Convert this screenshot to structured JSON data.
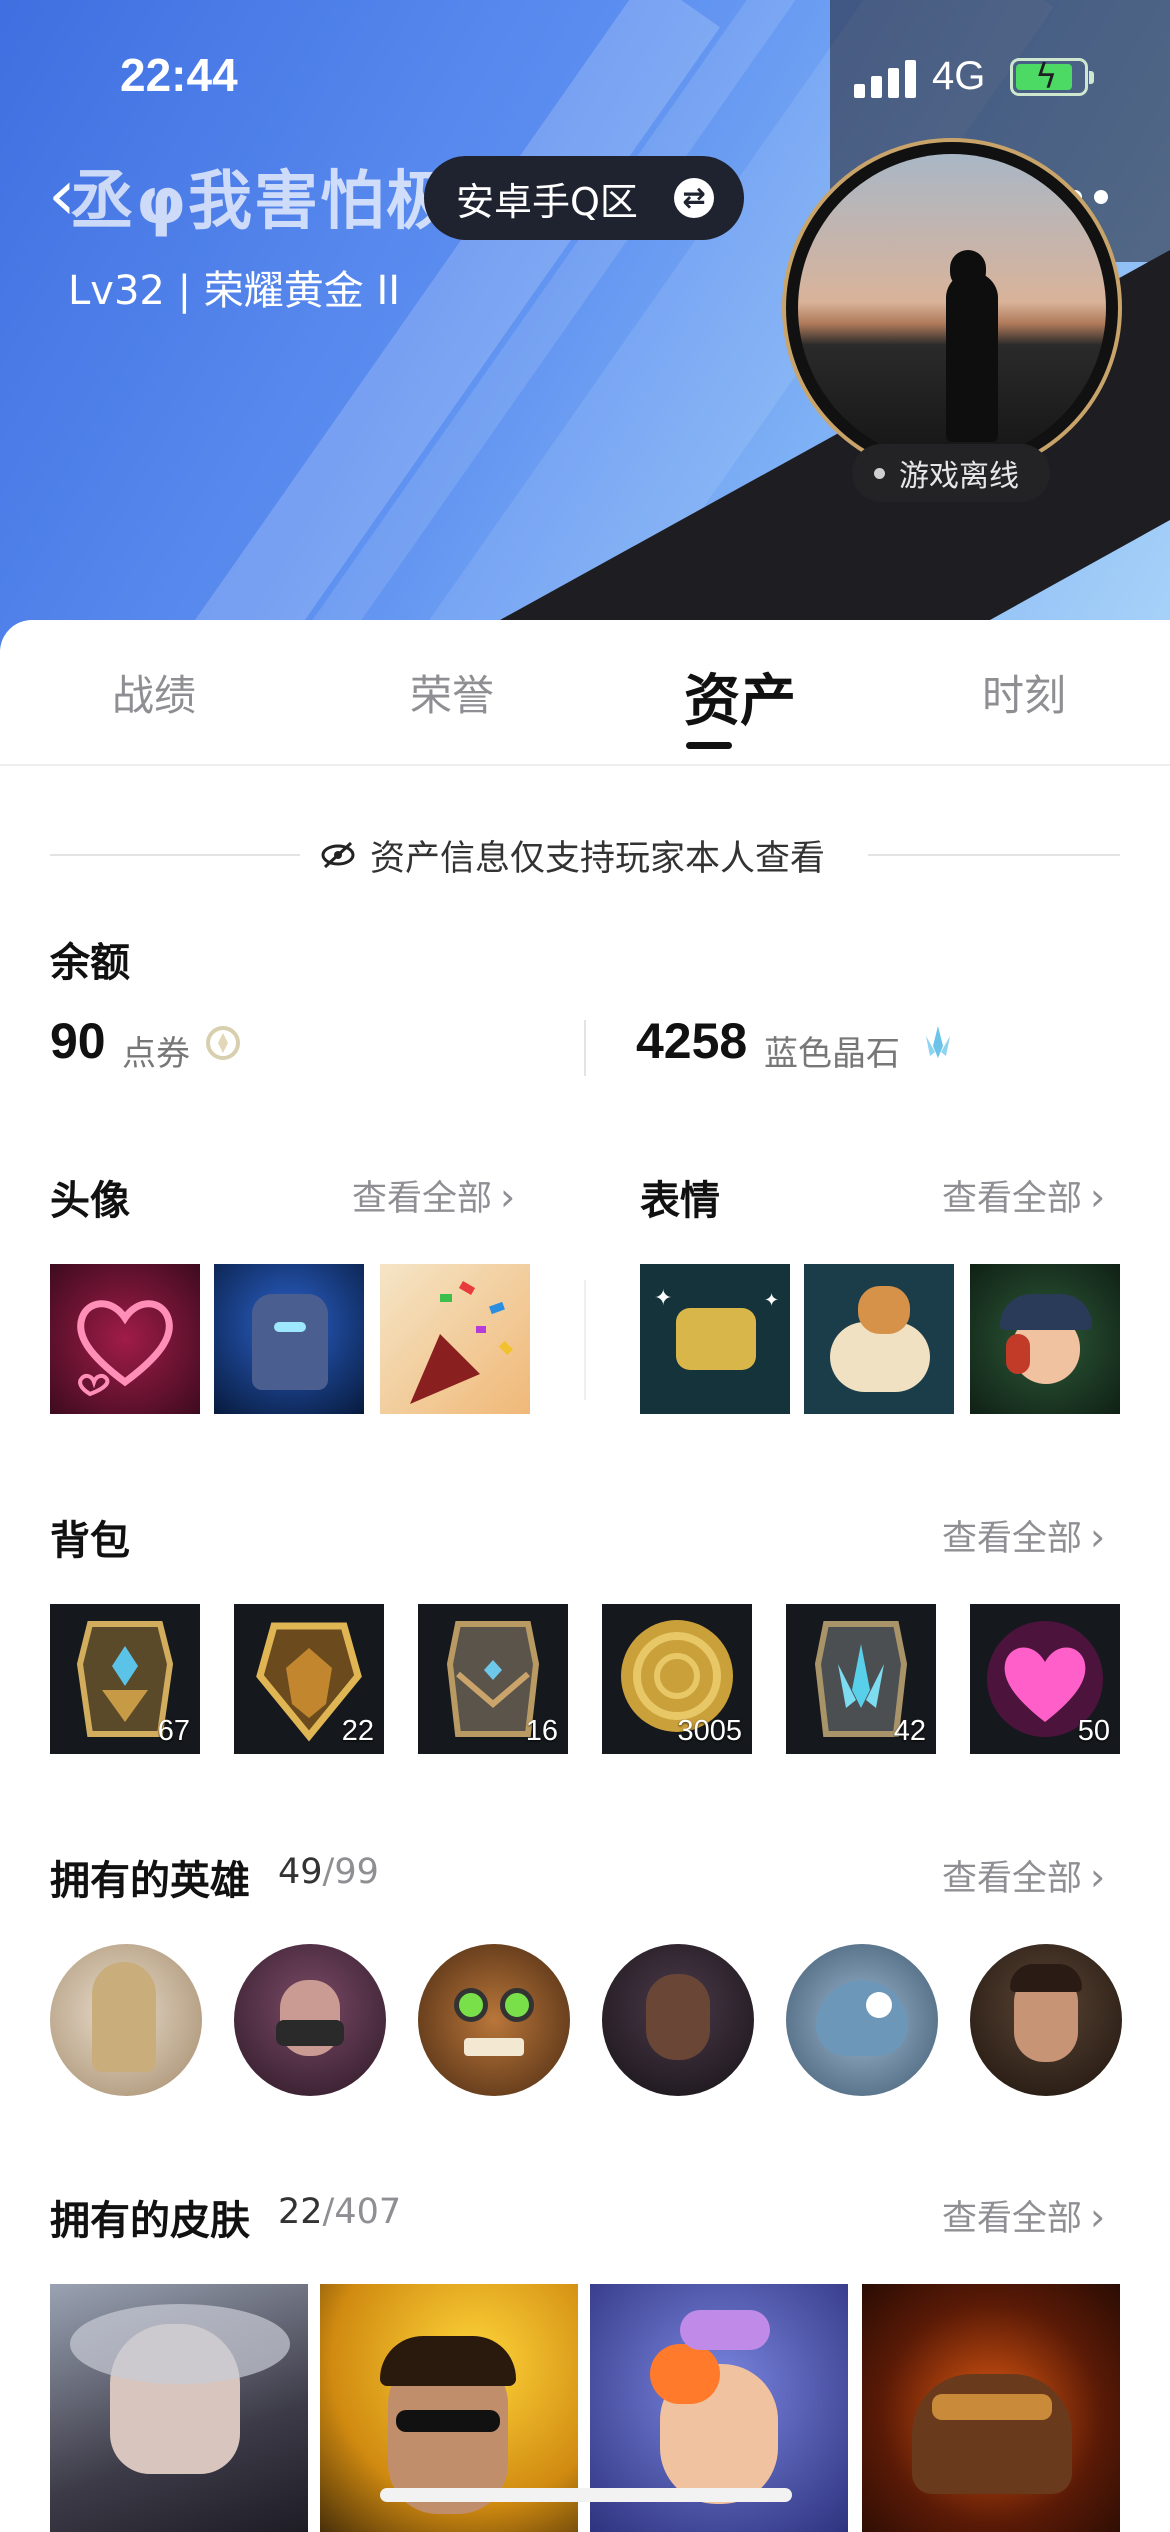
{
  "status_bar": {
    "time": "22:44",
    "network": "4G"
  },
  "header": {
    "nickname": "丞φ我害怕极了",
    "region": "安卓手Q区",
    "level": "Lv32 | 荣耀黄金 II",
    "presence": "游戏离线"
  },
  "tabs": [
    "战绩",
    "荣誉",
    "资产",
    "时刻"
  ],
  "active_tab": "资产",
  "notice": "资产信息仅支持玩家本人查看",
  "balance": {
    "title": "余额",
    "points": {
      "value": "90",
      "unit": "点券"
    },
    "crystals": {
      "value": "4258",
      "unit": "蓝色晶石"
    }
  },
  "avatars": {
    "title": "头像",
    "view_all": "查看全部"
  },
  "emotes": {
    "title": "表情",
    "view_all": "查看全部"
  },
  "backpack": {
    "title": "背包",
    "view_all": "查看全部",
    "items": [
      {
        "icon": "gold-chest-blue-gem-icon",
        "count": "67"
      },
      {
        "icon": "gold-crest-chest-icon",
        "count": "22"
      },
      {
        "icon": "gold-chest-icon",
        "count": "16"
      },
      {
        "icon": "gold-coin-icon",
        "count": "3005"
      },
      {
        "icon": "blue-crystal-chest-icon",
        "count": "42"
      },
      {
        "icon": "pink-heart-icon",
        "count": "50"
      }
    ]
  },
  "heroes": {
    "title": "拥有的英雄",
    "owned": "49",
    "total": "/99",
    "view_all": "查看全部"
  },
  "skins": {
    "title": "拥有的皮肤",
    "owned": "22",
    "total": "/407",
    "view_all": "查看全部"
  },
  "colors": {
    "accent": "#111111",
    "muted": "#8e8e93",
    "header_blue": "#5b8df0",
    "dark_panel": "#1e1e22"
  }
}
